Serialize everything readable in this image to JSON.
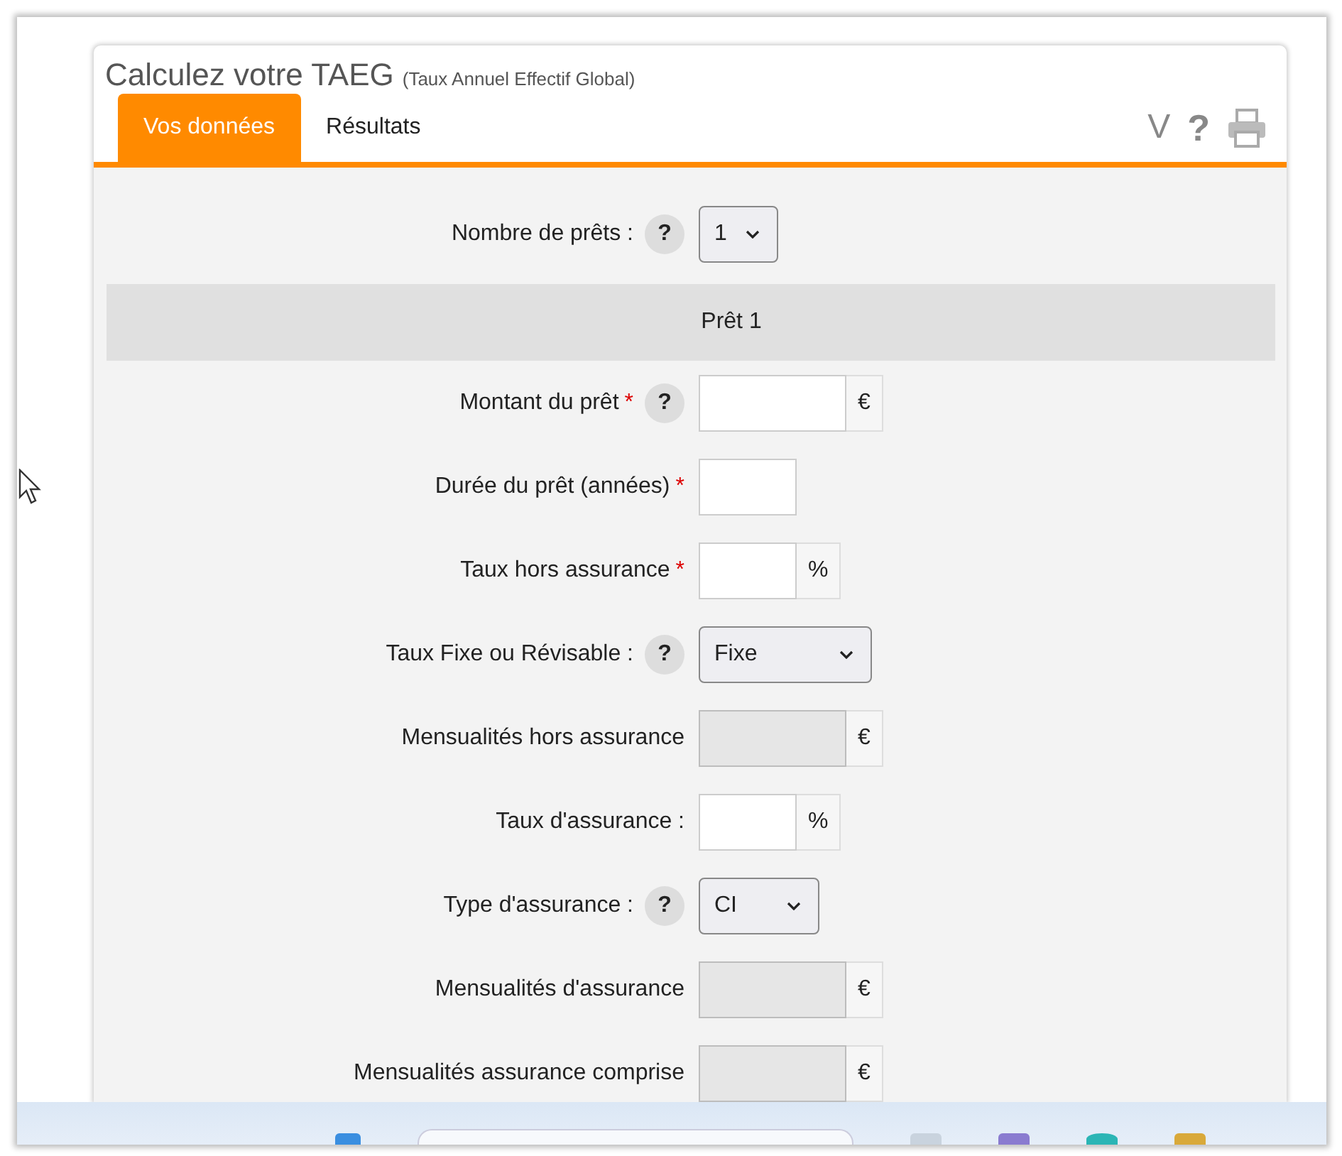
{
  "title": "Calculez votre TAEG",
  "subtitle": "(Taux Annuel Effectif Global)",
  "tabs": [
    {
      "label": "Vos données",
      "selected": true
    },
    {
      "label": "Résultats",
      "selected": false
    }
  ],
  "toolbar": [
    {
      "kind": "chevron",
      "glyph": "V"
    },
    {
      "kind": "help",
      "glyph": "?"
    },
    {
      "kind": "print"
    }
  ],
  "required_mark": "*",
  "rows": [
    {
      "kind": "select",
      "label": "Nombre de prêts :",
      "help": "?",
      "value": "1"
    },
    {
      "kind": "section",
      "label": "Prêt 1"
    },
    {
      "kind": "input",
      "label": "Montant du prêt",
      "required": true,
      "help": "?",
      "unit": "€",
      "disabled": false
    },
    {
      "kind": "input",
      "label": "Durée du prêt (années)",
      "required": true,
      "disabled": false
    },
    {
      "kind": "input",
      "label": "Taux hors assurance",
      "required": true,
      "unit": "%",
      "disabled": false
    },
    {
      "kind": "select",
      "label": "Taux Fixe ou Révisable :",
      "help": "?",
      "value": "Fixe"
    },
    {
      "kind": "input",
      "label": "Mensualités hors assurance",
      "unit": "€",
      "disabled": true
    },
    {
      "kind": "input",
      "label": "Taux d'assurance :",
      "unit": "%",
      "disabled": false
    },
    {
      "kind": "select",
      "label": "Type d'assurance :",
      "help": "?",
      "value": "CI"
    },
    {
      "kind": "input",
      "label": "Mensualités d'assurance",
      "unit": "€",
      "disabled": true
    },
    {
      "kind": "input",
      "label": "Mensualités assurance comprise",
      "unit": "€",
      "disabled": true
    }
  ]
}
